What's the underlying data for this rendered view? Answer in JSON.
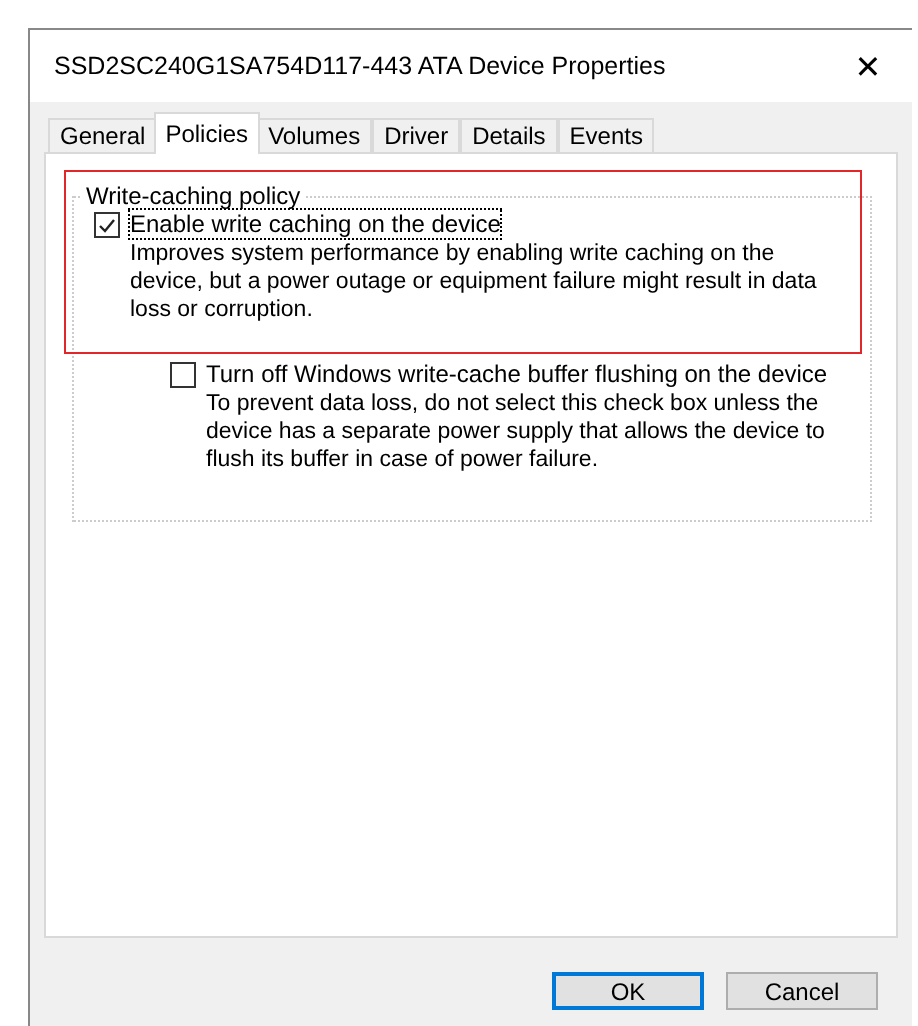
{
  "window": {
    "title": "SSD2SC240G1SA754D117-443 ATA Device Properties",
    "close": "✕"
  },
  "tabs": [
    {
      "label": "General",
      "selected": false
    },
    {
      "label": "Policies",
      "selected": true
    },
    {
      "label": "Volumes",
      "selected": false
    },
    {
      "label": "Driver",
      "selected": false
    },
    {
      "label": "Details",
      "selected": false
    },
    {
      "label": "Events",
      "selected": false
    }
  ],
  "group": {
    "title": "Write-caching policy",
    "options": [
      {
        "label": "Enable write caching on the device",
        "checked": true,
        "focused": true,
        "indented": false,
        "description": "Improves system performance by enabling write caching on the device, but a power outage or equipment failure might result in data loss or corruption."
      },
      {
        "label": "Turn off Windows write-cache buffer flushing on the device",
        "checked": false,
        "focused": false,
        "indented": true,
        "description": "To prevent data loss, do not select this check box unless the device has a separate power supply that allows the device to flush its buffer in case of power failure."
      }
    ]
  },
  "buttons": [
    {
      "label": "OK",
      "default": true
    },
    {
      "label": "Cancel",
      "default": false
    }
  ]
}
